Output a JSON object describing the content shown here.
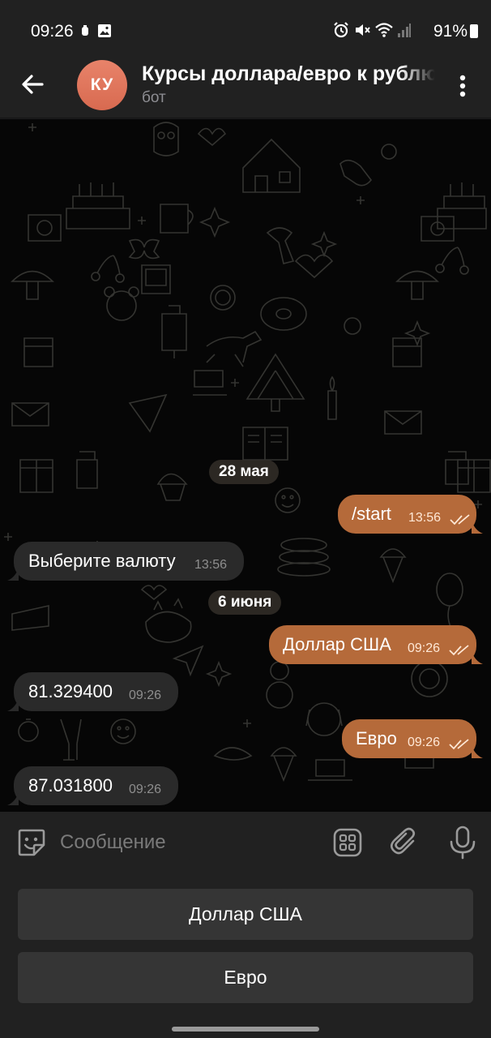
{
  "status_bar": {
    "time": "09:26",
    "battery": "91%"
  },
  "header": {
    "avatar_initials": "КУ",
    "title": "Курсы доллара/евро к рублю",
    "subtitle": "бот"
  },
  "messages": [
    {
      "type": "date",
      "text": "28 мая"
    },
    {
      "type": "out",
      "text": "/start",
      "time": "13:56"
    },
    {
      "type": "in",
      "text": "Выберите валюту",
      "time": "13:56"
    },
    {
      "type": "date",
      "text": "6 июня"
    },
    {
      "type": "out",
      "text": "Доллар США",
      "time": "09:26"
    },
    {
      "type": "in",
      "text": "81.329400",
      "time": "09:26"
    },
    {
      "type": "out",
      "text": "Евро",
      "time": "09:26"
    },
    {
      "type": "in",
      "text": "87.031800",
      "time": "09:26"
    }
  ],
  "input": {
    "placeholder": "Сообщение"
  },
  "bot_keyboard": {
    "buttons": [
      "Доллар США",
      "Евро"
    ]
  },
  "colors": {
    "outgoing_bubble": "#b56a3a",
    "incoming_bubble": "#2a2a2a",
    "avatar": "#e07a5f",
    "background": "#060606"
  }
}
